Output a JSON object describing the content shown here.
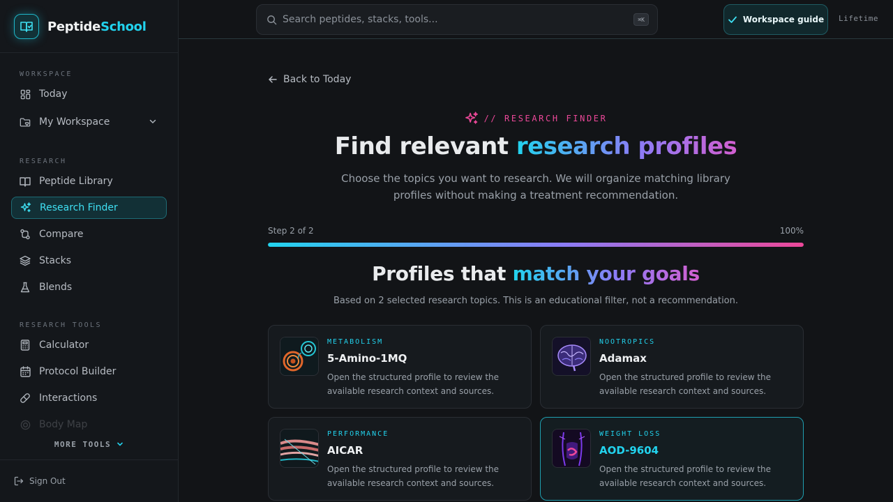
{
  "brand": {
    "part1": "Peptide",
    "part2": "School"
  },
  "sidebar": {
    "sections": {
      "workspace": "WORKSPACE",
      "research": "RESEARCH",
      "tools": "RESEARCH TOOLS"
    },
    "items": {
      "today": "Today",
      "my_workspace": "My Workspace",
      "peptide_library": "Peptide Library",
      "research_finder": "Research Finder",
      "compare": "Compare",
      "stacks": "Stacks",
      "blends": "Blends",
      "calculator": "Calculator",
      "protocol_builder": "Protocol Builder",
      "interactions": "Interactions",
      "body_map": "Body Map"
    },
    "active_item": "Research Finder",
    "more_tools": "MORE TOOLS",
    "sign_out": "Sign Out"
  },
  "topbar": {
    "search_placeholder": "Search peptides, stacks, tools...",
    "search_shortcut": "⌘K",
    "guide_button": "Workspace guide",
    "plan": "Lifetime"
  },
  "main": {
    "back_link": "Back to Today",
    "eyebrow": "// RESEARCH FINDER",
    "title_plain": "Find relevant ",
    "title_accent": "research profiles",
    "subtitle": "Choose the topics you want to research. We will organize matching library profiles without making a treatment recommendation.",
    "step_label": "Step 2 of 2",
    "step_percent": "100%",
    "progress_value": 1.0,
    "results_title_plain": "Profiles that ",
    "results_title_accent": "match your goals",
    "results_subtitle": "Based on 2 selected research topics. This is an educational filter, not a recommendation.",
    "cards": [
      {
        "category": "METABOLISM",
        "name": "5-Amino-1MQ",
        "description": "Open the structured profile to review the available research context and sources.",
        "selected": false
      },
      {
        "category": "NOOTROPICS",
        "name": "Adamax",
        "description": "Open the structured profile to review the available research context and sources.",
        "selected": false
      },
      {
        "category": "PERFORMANCE",
        "name": "AICAR",
        "description": "Open the structured profile to review the available research context and sources.",
        "selected": false
      },
      {
        "category": "WEIGHT LOSS",
        "name": "AOD-9604",
        "description": "Open the structured profile to review the available research context and sources.",
        "selected": true
      }
    ]
  },
  "colors": {
    "accent_cyan": "#22d3ee",
    "accent_pink": "#ec4899",
    "accent_violet": "#8b7cf6",
    "background": "#121417"
  }
}
